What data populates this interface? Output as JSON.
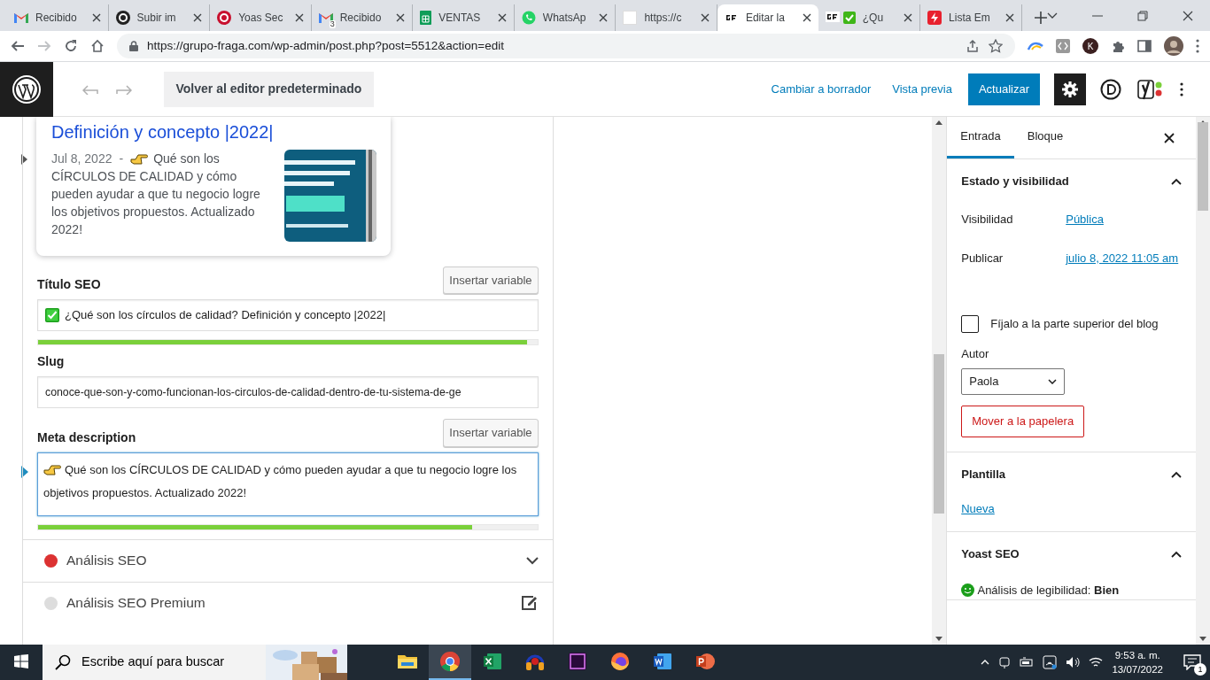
{
  "browser": {
    "tabs": [
      {
        "title": "Recibido",
        "kind": "gmail",
        "selected": false
      },
      {
        "title": "Subir im",
        "kind": "dark-circle",
        "selected": false
      },
      {
        "title": "Yoas Sec",
        "kind": "red-circle",
        "selected": false
      },
      {
        "title": "Recibido",
        "kind": "gmail",
        "badge": "3",
        "selected": false
      },
      {
        "title": "VENTAS",
        "kind": "sheets",
        "selected": false
      },
      {
        "title": "WhatsAp",
        "kind": "whatsapp",
        "selected": false
      },
      {
        "title": "https://c",
        "kind": "blank",
        "selected": false
      },
      {
        "title": "Editar la",
        "kind": "gf",
        "selected": true
      },
      {
        "title": "¿Qu",
        "kind": "gf-check",
        "selected": false
      },
      {
        "title": "Lista Em",
        "kind": "flash",
        "selected": false
      }
    ],
    "url": "https://grupo-fraga.com/wp-admin/post.php?post=5512&action=edit",
    "profile_initial": "K"
  },
  "toolbar": {
    "back_editor": "Volver al editor predeterminado",
    "switch_draft": "Cambiar a borrador",
    "preview": "Vista previa",
    "update": "Actualizar",
    "settings_pressed": true
  },
  "snippet": {
    "title": "Definición y concepto |2022|",
    "date": "Jul 8, 2022",
    "separator": "-",
    "description": "Qué son los CÍRCULOS DE CALIDAD y cómo pueden ayudar a que tu negocio logre los objetivos propuestos. Actualizado 2022!"
  },
  "seo_title": {
    "label": "Título SEO",
    "insert": "Insertar variable",
    "value": "¿Qué son los círculos de calidad? Definición y concepto |2022|",
    "level": 0.98
  },
  "slug": {
    "label": "Slug",
    "value": "conoce-que-son-y-como-funcionan-los-circulos-de-calidad-dentro-de-tu-sistema-de-ge"
  },
  "meta": {
    "label": "Meta description",
    "insert": "Insertar variable",
    "value": "Qué son los CÍRCULOS DE CALIDAD y cómo pueden ayudar a que tu negocio logre los objetivos propuestos. Actualizado 2022!",
    "level": 0.87,
    "focused": true
  },
  "analyses": [
    {
      "label": "Análisis SEO",
      "color": "#dc3232",
      "kind": "collapsible",
      "expanded": false
    },
    {
      "label": "Análisis SEO Premium",
      "color": "#dddddd",
      "kind": "premium"
    }
  ],
  "sidebar": {
    "tabs": [
      {
        "label": "Entrada",
        "selected": true
      },
      {
        "label": "Bloque",
        "selected": false
      }
    ],
    "status": {
      "title": "Estado y visibilidad",
      "expanded": true,
      "rows": [
        {
          "label": "Visibilidad",
          "value": "Pública"
        },
        {
          "label": "Publicar",
          "value": "julio 8, 2022 11:05 am"
        }
      ],
      "sticky": {
        "label": "Fíjalo a la parte superior del blog",
        "checked": false
      },
      "author": {
        "label": "Autor",
        "value": "Paola"
      },
      "trash": "Mover a la papelera"
    },
    "template": {
      "title": "Plantilla",
      "expanded": true,
      "link": "Nueva"
    },
    "yoast": {
      "title": "Yoast SEO",
      "expanded": true,
      "readability": "Análisis de legibilidad: **Bien**"
    }
  },
  "taskbar": {
    "search_placeholder": "Escribe aquí para buscar",
    "apps": [
      {
        "kind": "explorer",
        "selected": false
      },
      {
        "kind": "chrome",
        "selected": true
      },
      {
        "kind": "excel",
        "selected": false
      },
      {
        "kind": "headphones",
        "selected": false
      },
      {
        "kind": "premiere",
        "selected": false
      },
      {
        "kind": "firefox",
        "selected": false
      },
      {
        "kind": "word",
        "selected": false
      },
      {
        "kind": "powerpoint",
        "selected": false
      }
    ],
    "time": "9:53 a. m.",
    "date": "13/07/2022",
    "notifications": "1"
  }
}
